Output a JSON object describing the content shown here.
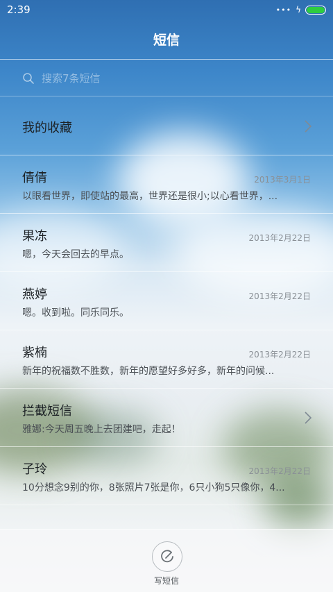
{
  "status_bar": {
    "time": "2:39",
    "signal_dots": "•••",
    "charging_glyph": "ϟ",
    "battery_level": 1.0,
    "battery_color": "#2ecc40"
  },
  "header": {
    "title": "短信"
  },
  "search": {
    "placeholder": "搜索7条短信",
    "value": ""
  },
  "favorites": {
    "label": "我的收藏"
  },
  "conversations": [
    {
      "name": "倩倩",
      "date": "2013年3月1日",
      "snippet": "以眼看世界，即使站的最高，世界还是很小;以心看世界，..."
    },
    {
      "name": "果冻",
      "date": "2013年2月22日",
      "snippet": "嗯，今天会回去的早点。"
    },
    {
      "name": "燕婷",
      "date": "2013年2月22日",
      "snippet": "嗯。收到啦。同乐同乐。"
    },
    {
      "name": "紫楠",
      "date": "2013年2月22日",
      "snippet": "新年的祝福数不胜数，新年的愿望好多好多，新年的问候..."
    }
  ],
  "blocked": {
    "name": "拦截短信",
    "snippet": "雅娜:今天周五晚上去团建吧，走起！"
  },
  "conversations_after": [
    {
      "name": "子玲",
      "date": "2013年2月22日",
      "snippet": "10分想念9别的你，8张照片7张是你，6只小狗5只像你，4..."
    }
  ],
  "compose": {
    "label": "写短信",
    "icon": "compose-icon"
  },
  "colors": {
    "title_text": "#ffffff",
    "primary_text": "#1d2226",
    "secondary_text": "#4a4f54",
    "date_text": "#8a9096"
  }
}
